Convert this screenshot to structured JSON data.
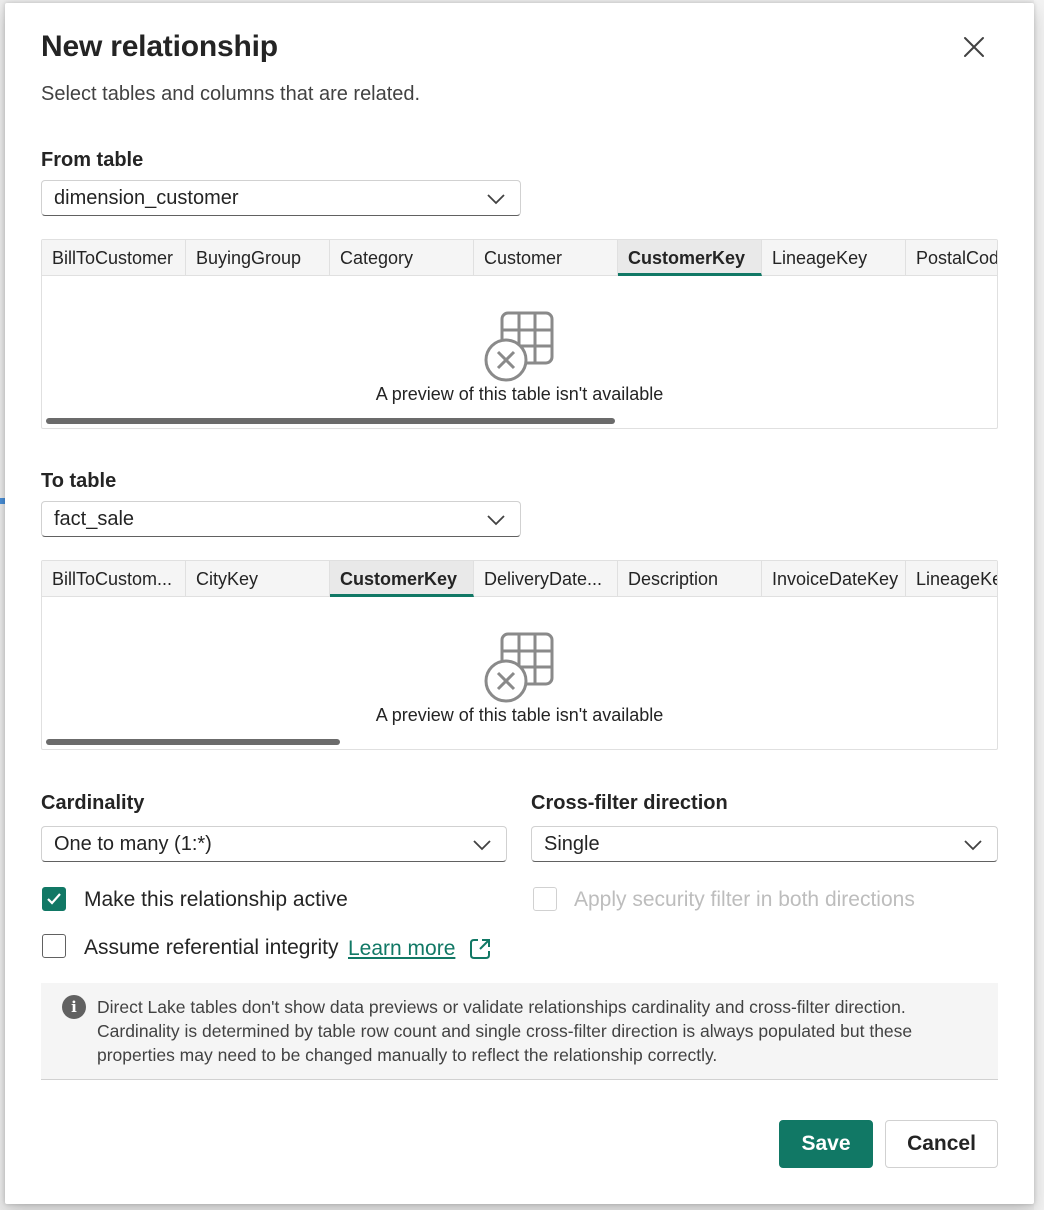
{
  "dialog": {
    "title": "New relationship",
    "subtitle": "Select tables and columns that are related."
  },
  "from_table": {
    "label": "From table",
    "value": "dimension_customer",
    "columns": [
      "BillToCustomer",
      "BuyingGroup",
      "Category",
      "Customer",
      "CustomerKey",
      "LineageKey",
      "PostalCode"
    ],
    "selected_column": "CustomerKey",
    "empty_message": "A preview of this table isn't available",
    "scroll_fraction": 0.6
  },
  "to_table": {
    "label": "To table",
    "value": "fact_sale",
    "columns": [
      "BillToCustom...",
      "CityKey",
      "CustomerKey",
      "DeliveryDate...",
      "Description",
      "InvoiceDateKey",
      "LineageKey"
    ],
    "selected_column": "CustomerKey",
    "empty_message": "A preview of this table isn't available",
    "scroll_fraction": 0.31
  },
  "cardinality": {
    "label": "Cardinality",
    "value": "One to many (1:*)"
  },
  "cross_filter": {
    "label": "Cross-filter direction",
    "value": "Single"
  },
  "options": {
    "active_label": "Make this relationship active",
    "active_checked": true,
    "security_label": "Apply security filter in both directions",
    "security_checked": false,
    "security_disabled": true,
    "integrity_label": "Assume referential integrity",
    "integrity_checked": false,
    "learn_more": "Learn more"
  },
  "info": {
    "icon": "info-icon",
    "text": "Direct Lake tables don't show data previews or validate relationships cardinality and cross-filter direction. Cardinality is determined by table row count and single cross-filter direction is always populated but these properties may need to be changed manually to reflect the relationship correctly."
  },
  "buttons": {
    "save": "Save",
    "cancel": "Cancel"
  },
  "colors": {
    "accent": "#117865",
    "disabled_text": "#bdbdbd"
  }
}
